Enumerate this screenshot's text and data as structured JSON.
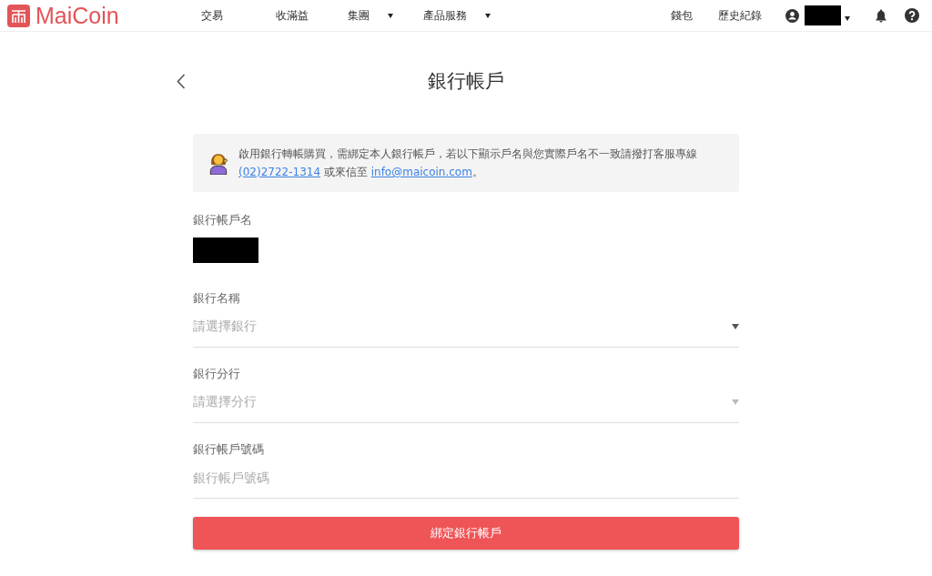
{
  "header": {
    "logo": "MaiCoin",
    "nav": [
      {
        "label": "交易",
        "has_menu": false
      },
      {
        "label": "收滿益",
        "has_menu": false
      },
      {
        "label": "集團",
        "has_menu": true
      },
      {
        "label": "產品服務",
        "has_menu": true
      }
    ],
    "right_nav": [
      {
        "label": "錢包"
      },
      {
        "label": "歷史紀錄"
      }
    ]
  },
  "page": {
    "title": "銀行帳戶",
    "notice": [
      {
        "kind": "text",
        "text": "啟用銀行轉帳購買，需綁定本人銀行帳戶，若以下顯示戶名與您實際戶名不一致請撥打客服專線 "
      },
      {
        "kind": "link",
        "text": "(02)2722-1314"
      },
      {
        "kind": "text",
        "text": " 或來信至 "
      },
      {
        "kind": "link",
        "text": "info@maicoin.com"
      },
      {
        "kind": "text",
        "text": "。"
      }
    ],
    "fields": [
      {
        "kind": "redacted",
        "label": "銀行帳戶名"
      },
      {
        "kind": "select",
        "label": "銀行名稱",
        "placeholder": "請選擇銀行",
        "disabled": false
      },
      {
        "kind": "select",
        "label": "銀行分行",
        "placeholder": "請選擇分行",
        "disabled": true
      },
      {
        "kind": "text",
        "label": "銀行帳戶號碼",
        "placeholder": "銀行帳戶號碼"
      }
    ],
    "submit": "綁定銀行帳戶"
  }
}
